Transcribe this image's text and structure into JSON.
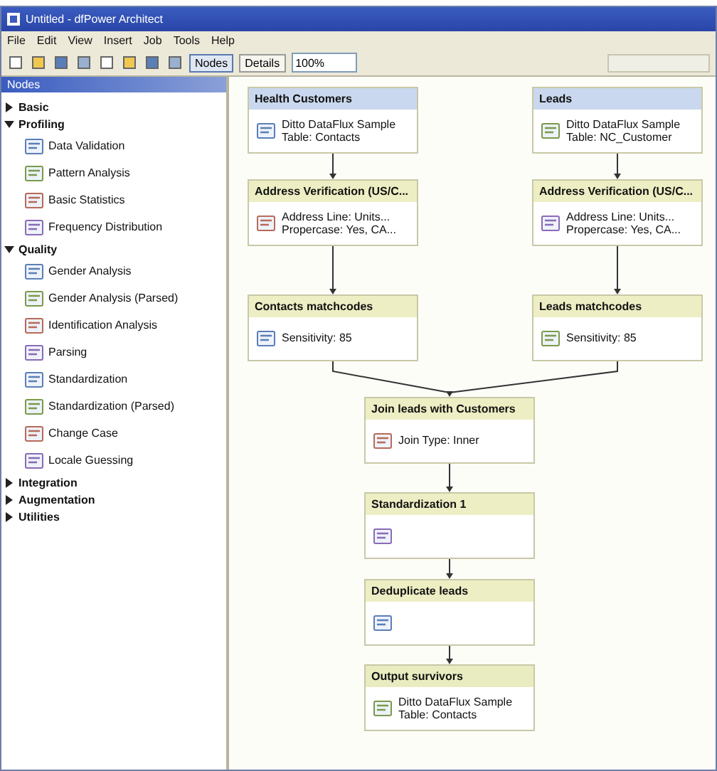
{
  "window": {
    "title": "Untitled - dfPower Architect"
  },
  "menu": [
    "File",
    "Edit",
    "View",
    "Insert",
    "Job",
    "Tools",
    "Help"
  ],
  "toolbar": {
    "buttons": [
      {
        "label": "Nodes",
        "selected": true
      },
      {
        "label": "Details",
        "selected": false
      }
    ],
    "zoom": "100%"
  },
  "sidebar": {
    "title": "Nodes",
    "items": [
      {
        "label": "Basic",
        "expanded": false
      },
      {
        "label": "Profiling",
        "expanded": true,
        "children": [
          {
            "label": "Data Validation"
          },
          {
            "label": "Pattern Analysis"
          },
          {
            "label": "Basic Statistics"
          },
          {
            "label": "Frequency Distribution"
          }
        ]
      },
      {
        "label": "Quality",
        "expanded": true,
        "children": [
          {
            "label": "Gender Analysis"
          },
          {
            "label": "Gender Analysis (Parsed)"
          },
          {
            "label": "Identification Analysis"
          },
          {
            "label": "Parsing"
          },
          {
            "label": "Standardization"
          },
          {
            "label": "Standardization (Parsed)"
          },
          {
            "label": "Change Case"
          },
          {
            "label": "Locale Guessing"
          }
        ]
      },
      {
        "label": "Integration",
        "expanded": false
      },
      {
        "label": "Augmentation",
        "expanded": false
      },
      {
        "label": "Utilities",
        "expanded": false
      }
    ]
  },
  "nodes": [
    {
      "kind": "source",
      "title": "Health Customers",
      "body": [
        "Ditto DataFlux Sample",
        "Table: Contacts"
      ]
    },
    {
      "kind": "source",
      "title": "Leads",
      "body": [
        "Ditto DataFlux Sample",
        "Table: NC_Customer"
      ]
    },
    {
      "kind": "step",
      "title": "Address Verification (US/C...",
      "body": [
        "Address Line: Units...",
        "Propercase: Yes, CA..."
      ]
    },
    {
      "kind": "step",
      "title": "Address Verification (US/C...",
      "body": [
        "Address Line: Units...",
        "Propercase: Yes, CA..."
      ]
    },
    {
      "kind": "step",
      "title": "Contacts matchcodes",
      "body": [
        "Sensitivity: 85"
      ]
    },
    {
      "kind": "step",
      "title": "Leads matchcodes",
      "body": [
        "Sensitivity: 85"
      ]
    },
    {
      "kind": "step",
      "title": "Join leads with Customers",
      "body": [
        "Join Type: Inner"
      ]
    },
    {
      "kind": "step",
      "title": "Standardization 1"
    },
    {
      "kind": "step",
      "title": "Deduplicate leads"
    },
    {
      "kind": "output",
      "title": "Output survivors",
      "body": [
        "Ditto DataFlux Sample",
        "Table: Contacts"
      ]
    }
  ]
}
